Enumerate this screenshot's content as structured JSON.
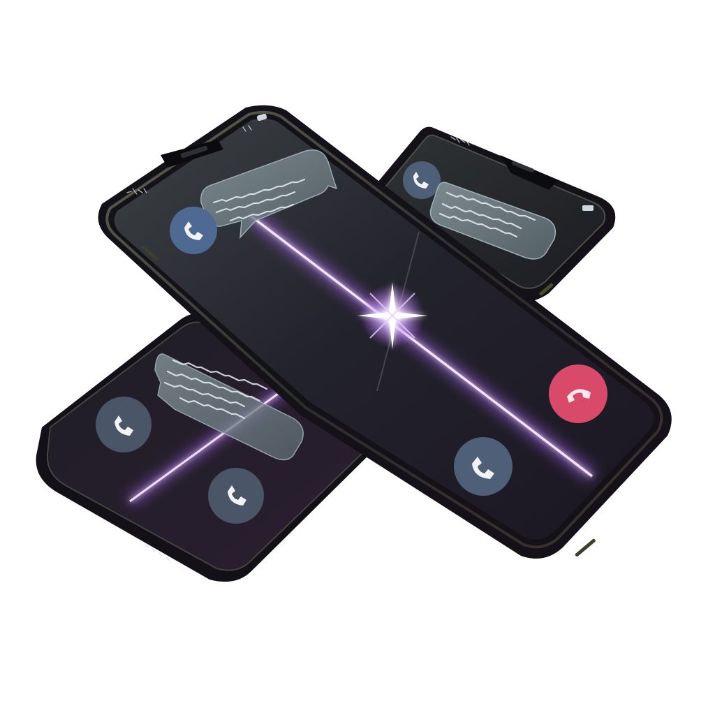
{
  "scene": {
    "description_free": true,
    "colors": {
      "background": "#ffffff",
      "phone_body": "#15131a",
      "phone_bezel": "#3a3d3a",
      "screen_dark": "#1a1a22",
      "accent_glow": "#b56bff",
      "call_accept": "#4e5f78",
      "call_decline": "#d94a6a",
      "bubble": "#6f7f86"
    },
    "phones": [
      {
        "id": "left",
        "icons": [
          "phone-icon",
          "phone-icon"
        ],
        "has_message_bubble": true
      },
      {
        "id": "back-right",
        "icons": [
          "phone-icon"
        ],
        "has_message_bubble": true
      },
      {
        "id": "front",
        "icons": [
          "phone-icon",
          "phone-icon",
          "decline-call-icon"
        ],
        "has_message_bubble": true
      }
    ]
  }
}
